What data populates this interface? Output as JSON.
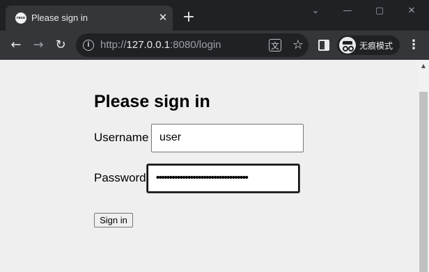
{
  "browser": {
    "tab": {
      "favicon_text": "reco",
      "title": "Please sign in",
      "close_glyph": "✕"
    },
    "new_tab_glyph": "+",
    "window_controls": {
      "minimize": "⌄",
      "restore": "—",
      "maximize": "▢",
      "close": "✕"
    },
    "nav": {
      "back": "←",
      "forward": "→",
      "reload": "↻"
    },
    "address": {
      "scheme": "http://",
      "host": "127.0.0.1",
      "rest": ":8080/login"
    },
    "icons": {
      "info": "i",
      "translate": "文",
      "star": "☆",
      "menu": "⋮"
    },
    "incognito_label": "无痕模式"
  },
  "page": {
    "heading": "Please sign in",
    "username": {
      "label": "Username",
      "value": "user"
    },
    "password": {
      "label": "Password",
      "masked_value": "•••••••••••••••••••••••••••••••••••"
    },
    "submit_label": "Sign in"
  }
}
